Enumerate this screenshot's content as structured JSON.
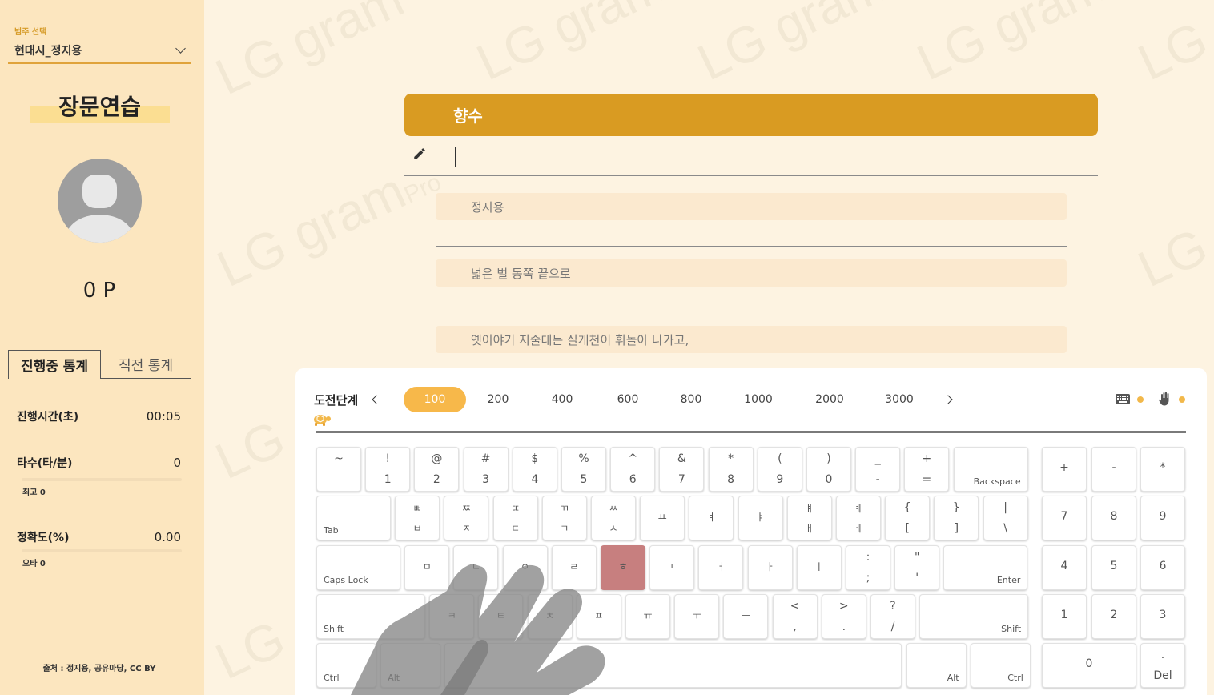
{
  "watermark": {
    "text": "LG gram",
    "pro": "Pro"
  },
  "sidebar": {
    "category_label": "범주 선택",
    "category_value": "현대시_정지용",
    "page_title": "장문연습",
    "points": "0 P",
    "tabs": {
      "active": "진행중 통계",
      "inactive": "직전 통계"
    },
    "stats": {
      "time_label": "진행시간(초)",
      "time_value": "00:05",
      "speed_label": "타수(타/분)",
      "speed_value": "0",
      "speed_best": "최고 0",
      "accuracy_label": "정확도(%)",
      "accuracy_value": "0.00",
      "accuracy_errors": "오타 0"
    },
    "source": "출처 : 정지용, 공유마당, CC BY"
  },
  "main": {
    "poem_title": "향수",
    "lines": [
      "정지용",
      "넓은 벌 동쪽 끝으로",
      "옛이야기 지줄대는 실개천이 휘돌아 나가고,"
    ]
  },
  "keyboard": {
    "stage_label": "도전단계",
    "levels": [
      "100",
      "200",
      "400",
      "600",
      "800",
      "1000",
      "2000",
      "3000"
    ],
    "active_level": "100",
    "accent_color": "#f7b84a",
    "highlight_key": "ㅎ",
    "rows": [
      [
        [
          "~",
          ""
        ],
        [
          "!",
          "1"
        ],
        [
          "@",
          "2"
        ],
        [
          "#",
          "3"
        ],
        [
          "$",
          "4"
        ],
        [
          "%",
          "5"
        ],
        [
          "^",
          "6"
        ],
        [
          "&",
          "7"
        ],
        [
          "*",
          "8"
        ],
        [
          "(",
          "9"
        ],
        [
          ")",
          "0"
        ],
        [
          "_",
          "-"
        ],
        [
          "+",
          "="
        ],
        [
          "Backspace"
        ]
      ],
      [
        [
          "Tab"
        ],
        [
          "ㅃ",
          "ㅂ"
        ],
        [
          "ㅉ",
          "ㅈ"
        ],
        [
          "ㄸ",
          "ㄷ"
        ],
        [
          "ㄲ",
          "ㄱ"
        ],
        [
          "ㅆ",
          "ㅅ"
        ],
        [
          "ㅛ"
        ],
        [
          "ㅕ"
        ],
        [
          "ㅑ"
        ],
        [
          "ㅒ",
          "ㅐ"
        ],
        [
          "ㅖ",
          "ㅔ"
        ],
        [
          "{",
          "["
        ],
        [
          "}",
          "]"
        ],
        [
          "|",
          "\\"
        ]
      ],
      [
        [
          "Caps Lock"
        ],
        [
          "ㅁ"
        ],
        [
          "ㄴ"
        ],
        [
          "ㅇ"
        ],
        [
          "ㄹ"
        ],
        [
          "ㅎ"
        ],
        [
          "ㅗ"
        ],
        [
          "ㅓ"
        ],
        [
          "ㅏ"
        ],
        [
          "ㅣ"
        ],
        [
          ":",
          ";"
        ],
        [
          "\"",
          "'"
        ],
        [
          "Enter"
        ]
      ],
      [
        [
          "Shift"
        ],
        [
          "ㅋ"
        ],
        [
          "ㅌ"
        ],
        [
          "ㅊ"
        ],
        [
          "ㅍ"
        ],
        [
          "ㅠ"
        ],
        [
          "ㅜ"
        ],
        [
          "ㅡ"
        ],
        [
          "<",
          ","
        ],
        [
          ">",
          "."
        ],
        [
          "?",
          "/"
        ],
        [
          "Shift"
        ]
      ],
      [
        [
          "Ctrl"
        ],
        [
          "Alt"
        ],
        [
          ""
        ],
        [
          "Alt"
        ],
        [
          "Ctrl"
        ]
      ]
    ],
    "numpad": [
      [
        "+"
      ],
      [
        "-"
      ],
      [
        "*"
      ],
      [
        "7"
      ],
      [
        "8"
      ],
      [
        "9"
      ],
      [
        "4"
      ],
      [
        "5"
      ],
      [
        "6"
      ],
      [
        "1"
      ],
      [
        "2"
      ],
      [
        "3"
      ],
      [
        "0"
      ],
      [
        ".",
        "Del"
      ]
    ]
  }
}
